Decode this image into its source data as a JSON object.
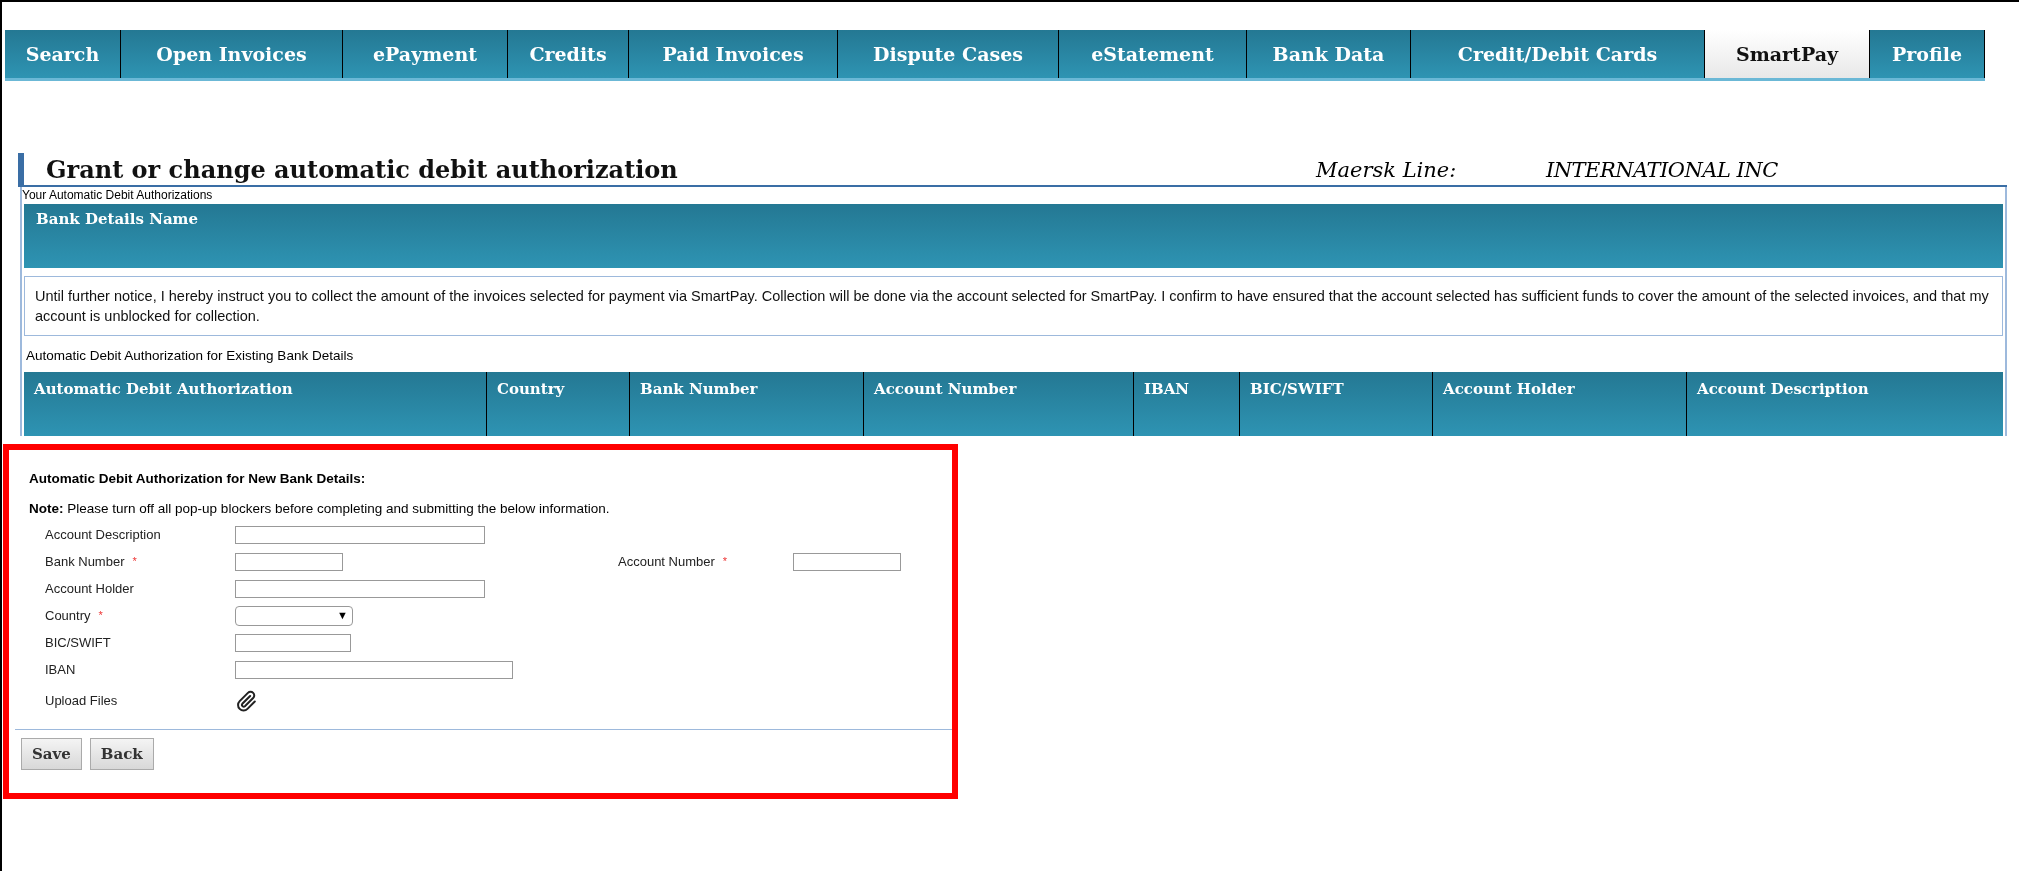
{
  "tabs": [
    {
      "label": "Search",
      "selected": false
    },
    {
      "label": "Open Invoices",
      "selected": false
    },
    {
      "label": "ePayment",
      "selected": false
    },
    {
      "label": "Credits",
      "selected": false
    },
    {
      "label": "Paid Invoices",
      "selected": false
    },
    {
      "label": "Dispute Cases",
      "selected": false
    },
    {
      "label": "eStatement",
      "selected": false
    },
    {
      "label": "Bank Data",
      "selected": false
    },
    {
      "label": "Credit/Debit Cards",
      "selected": false
    },
    {
      "label": "SmartPay",
      "selected": true
    },
    {
      "label": "Profile",
      "selected": false
    }
  ],
  "page_title": "Grant or change automatic debit authorization",
  "company_label": "Maersk Line:",
  "company_name": "INTERNATIONAL INC",
  "authorizations": {
    "caption": "Your Automatic Debit Authorizations",
    "header": "Bank Details Name",
    "notice": "Until further notice, I hereby instruct you to collect the amount of the invoices selected for payment via SmartPay. Collection will be done via the account selected for SmartPay. I confirm to have ensured that the account selected has sufficient funds to cover the amount of the selected invoices, and that my account is unblocked for collection."
  },
  "existing": {
    "caption": "Automatic Debit Authorization for Existing Bank Details",
    "columns": [
      "Automatic Debit Authorization",
      "Country",
      "Bank Number",
      "Account Number",
      "IBAN",
      "BIC/SWIFT",
      "Account Holder",
      "Account Description"
    ]
  },
  "new_details": {
    "heading": "Automatic Debit Authorization for New Bank Details:",
    "note_label": "Note:",
    "note": "Please turn off all pop-up blockers before completing and submitting the below information.",
    "rows": [
      [
        {
          "label": "Account Description",
          "required": false,
          "kind": "text"
        }
      ],
      [
        {
          "label": "Bank Number",
          "required": true,
          "kind": "text"
        },
        {
          "label": "Account Number",
          "required": true,
          "kind": "text"
        }
      ],
      [
        {
          "label": "Account Holder",
          "required": false,
          "kind": "text"
        }
      ],
      [
        {
          "label": "Country",
          "required": true,
          "kind": "select"
        }
      ],
      [
        {
          "label": "BIC/SWIFT",
          "required": false,
          "kind": "text"
        }
      ],
      [
        {
          "label": "IBAN",
          "required": false,
          "kind": "text"
        }
      ],
      [
        {
          "label": "Upload Files",
          "required": false,
          "kind": "upload"
        }
      ]
    ],
    "required_mark": "*",
    "select_arrow": "▼",
    "buttons": [
      "Save",
      "Back"
    ]
  }
}
